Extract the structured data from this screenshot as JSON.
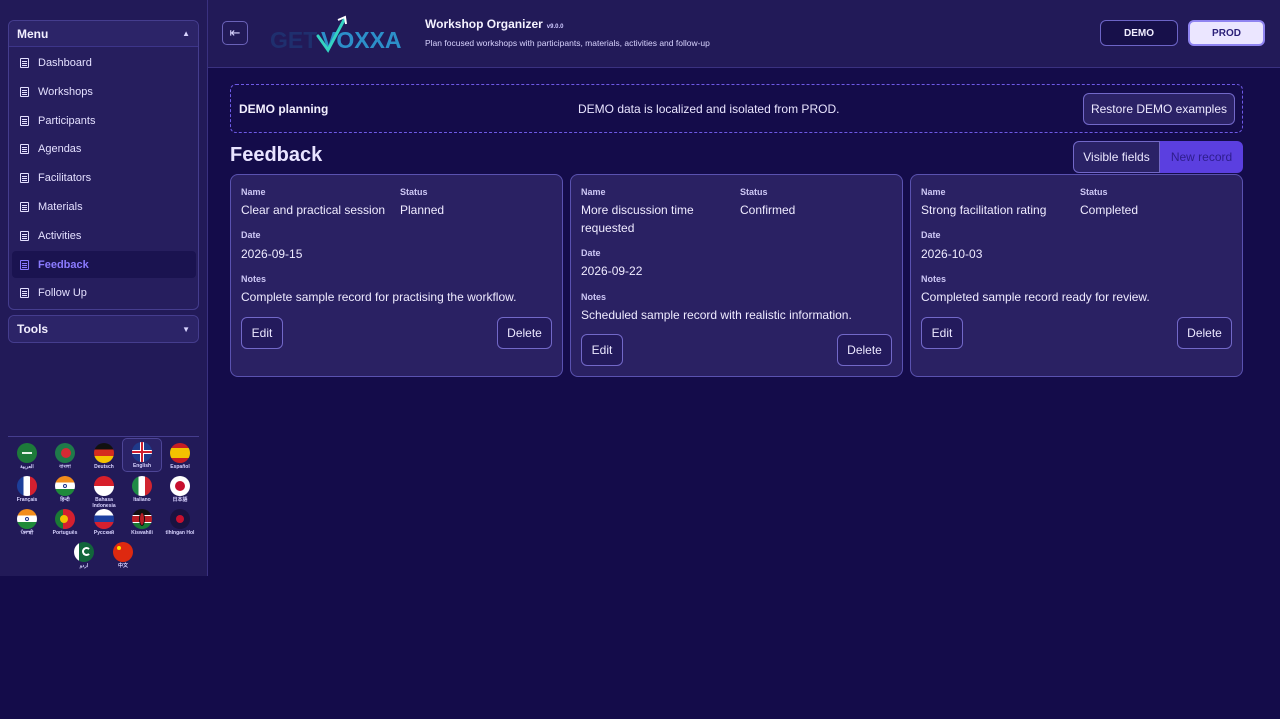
{
  "sidebar": {
    "menu_title": "Menu",
    "tools_title": "Tools",
    "items": [
      {
        "label": "Dashboard"
      },
      {
        "label": "Workshops"
      },
      {
        "label": "Participants"
      },
      {
        "label": "Agendas"
      },
      {
        "label": "Facilitators"
      },
      {
        "label": "Materials"
      },
      {
        "label": "Activities"
      },
      {
        "label": "Feedback"
      },
      {
        "label": "Follow Up"
      }
    ],
    "active_item": "Feedback",
    "languages": [
      {
        "label": "العربية"
      },
      {
        "label": "বাংলা"
      },
      {
        "label": "Deutsch"
      },
      {
        "label": "English"
      },
      {
        "label": "Español"
      },
      {
        "label": "Français"
      },
      {
        "label": "हिन्दी"
      },
      {
        "label": "Bahasa Indonesia"
      },
      {
        "label": "Italiano"
      },
      {
        "label": "日本語"
      },
      {
        "label": "ਪੰਜਾਬੀ"
      },
      {
        "label": "Português"
      },
      {
        "label": "Русский"
      },
      {
        "label": "Kiswahili"
      },
      {
        "label": "tlhIngan Hol"
      },
      {
        "label": "اردو"
      },
      {
        "label": "中文"
      }
    ],
    "selected_language": "English"
  },
  "header": {
    "logo_text_1": "GET",
    "logo_text_2": "VOXXA",
    "title": "Workshop Organizer",
    "version": "v9.0.0",
    "subtitle": "Plan focused workshops with participants, materials, activities and follow-up",
    "env_demo": "DEMO",
    "env_prod": "PROD"
  },
  "banner": {
    "title": "DEMO planning",
    "message": "DEMO data is localized and isolated from PROD.",
    "restore_label": "Restore DEMO examples"
  },
  "section": {
    "title": "Feedback",
    "visible_fields_label": "Visible fields",
    "new_record_label": "New record"
  },
  "cards": [
    {
      "name_label": "Name",
      "name": "Clear and practical session",
      "status_label": "Status",
      "status": "Planned",
      "date_label": "Date",
      "date": "2026-09-15",
      "notes_label": "Notes",
      "notes": "Complete sample record for practising the workflow.",
      "edit_label": "Edit",
      "delete_label": "Delete"
    },
    {
      "name_label": "Name",
      "name": "More discussion time requested",
      "status_label": "Status",
      "status": "Confirmed",
      "date_label": "Date",
      "date": "2026-09-22",
      "notes_label": "Notes",
      "notes": "Scheduled sample record with realistic information.",
      "edit_label": "Edit",
      "delete_label": "Delete"
    },
    {
      "name_label": "Name",
      "name": "Strong facilitation rating",
      "status_label": "Status",
      "status": "Completed",
      "date_label": "Date",
      "date": "2026-10-03",
      "notes_label": "Notes",
      "notes": "Completed sample record ready for review.",
      "edit_label": "Edit",
      "delete_label": "Delete"
    }
  ],
  "colors": {
    "background": "#140c4a",
    "panel": "#221a58",
    "accent": "#5b3fe0",
    "active_text": "#8b7bff"
  },
  "icons": {
    "collapse": "collapse-sidebar-icon",
    "menu_item": "document-icon",
    "menu_caret": "caret-up-icon",
    "tools_caret": "caret-down-icon"
  }
}
